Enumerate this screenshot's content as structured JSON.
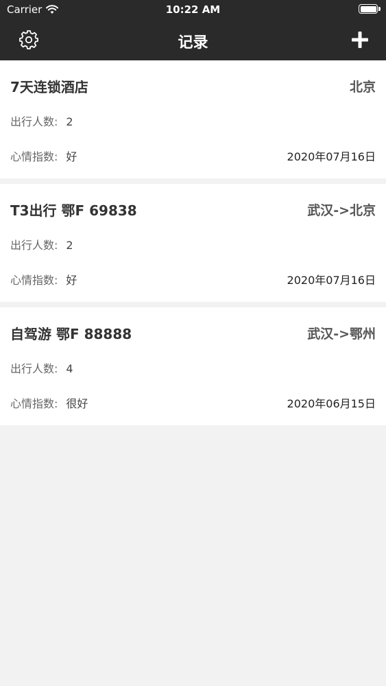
{
  "status_bar": {
    "carrier": "Carrier",
    "time": "10:22 AM",
    "wifi_icon": "wifi-icon",
    "battery_icon": "battery-icon"
  },
  "nav": {
    "title": "记录",
    "left_icon": "gear-icon",
    "right_icon": "plus-icon"
  },
  "records": [
    {
      "title": "7天连锁酒店",
      "route": "北京",
      "people_label": "出行人数:",
      "people_value": "2",
      "mood_label": "心情指数:",
      "mood_value": "好",
      "date": "2020年07月16日"
    },
    {
      "title": "T3出行 鄂F 69838",
      "route": "武汉->北京",
      "people_label": "出行人数:",
      "people_value": "2",
      "mood_label": "心情指数:",
      "mood_value": "好",
      "date": "2020年07月16日"
    },
    {
      "title": "自驾游 鄂F 88888",
      "route": "武汉->鄂州",
      "people_label": "出行人数:",
      "people_value": "4",
      "mood_label": "心情指数:",
      "mood_value": "很好",
      "date": "2020年06月15日"
    }
  ],
  "colors": {
    "header_bg": "#2a2a2a",
    "page_bg": "#f2f2f2",
    "card_bg": "#ffffff"
  }
}
